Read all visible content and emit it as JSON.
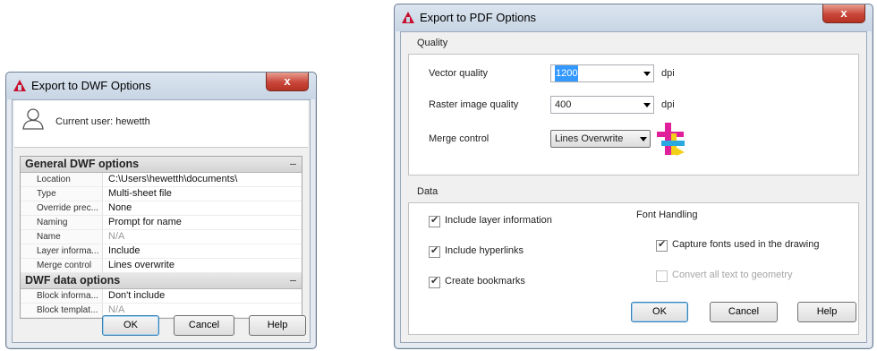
{
  "dwf_dialog": {
    "title": "Export to DWF Options",
    "close_glyph": "x",
    "current_user": "Current user: hewetth",
    "categories": [
      {
        "name": "General DWF options",
        "collapse_glyph": "–",
        "rows": [
          {
            "name": "Location",
            "value": "C:\\Users\\hewetth\\documents\\"
          },
          {
            "name": "Type",
            "value": "Multi-sheet file"
          },
          {
            "name": "Override prec...",
            "value": "None"
          },
          {
            "name": "Naming",
            "value": "Prompt for name"
          },
          {
            "name": "Name",
            "value": "N/A"
          },
          {
            "name": "Layer informa...",
            "value": "Include"
          },
          {
            "name": "Merge control",
            "value": "Lines overwrite"
          }
        ]
      },
      {
        "name": "DWF data options",
        "collapse_glyph": "–",
        "rows": [
          {
            "name": "Block informa...",
            "value": "Don't include"
          },
          {
            "name": "Block templat...",
            "value": "N/A"
          }
        ]
      }
    ],
    "buttons": {
      "ok": "OK",
      "cancel": "Cancel",
      "help": "Help"
    }
  },
  "pdf_dialog": {
    "title": "Export to PDF Options",
    "close_glyph": "x",
    "quality": {
      "group_label": "Quality",
      "vector_label": "Vector quality",
      "vector_value": "1200",
      "vector_unit": "dpi",
      "raster_label": "Raster image quality",
      "raster_value": "400",
      "raster_unit": "dpi",
      "merge_label": "Merge control",
      "merge_value": "Lines Overwrite"
    },
    "data": {
      "group_label": "Data",
      "include_layer": {
        "label": "Include layer information",
        "checked": true
      },
      "include_hyperlinks": {
        "label": "Include hyperlinks",
        "checked": true
      },
      "create_bookmarks": {
        "label": "Create bookmarks",
        "checked": true
      },
      "font_heading": "Font Handling",
      "capture_fonts": {
        "label": "Capture fonts used in the drawing",
        "checked": true
      },
      "convert_text": {
        "label": "Convert all text to geometry",
        "checked": false,
        "disabled": true
      }
    },
    "buttons": {
      "ok": "OK",
      "cancel": "Cancel",
      "help": "Help"
    }
  },
  "colors": {
    "autocad_logo": "#c8102e",
    "close_button": "#c9463a",
    "selection": "#3399ff",
    "merge_icon_magenta": "#e0209a",
    "merge_icon_yellow": "#f2d01a",
    "merge_icon_cyan": "#29a9e0"
  },
  "icons": [
    "autocad-logo-icon",
    "close-icon",
    "user-icon",
    "chevron-down-icon",
    "merge-control-icon",
    "checkmark-icon"
  ]
}
